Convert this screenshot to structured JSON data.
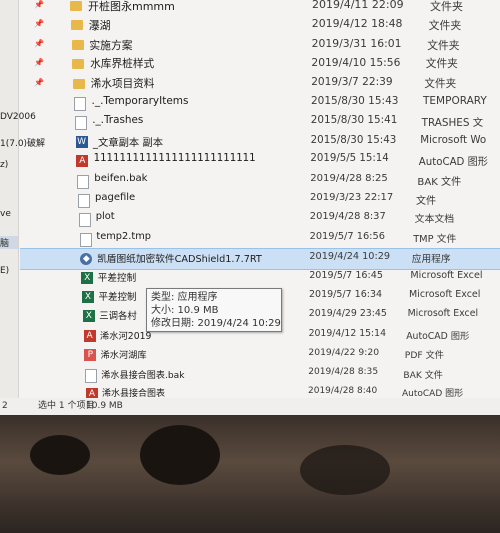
{
  "left_pane": {
    "items": [
      "DV2006",
      "1(7.0)破解",
      "z)",
      "ve",
      "脑",
      "E)"
    ]
  },
  "files": [
    {
      "name": "开桩图永mmmm",
      "date": "2019/4/11 22:09",
      "type": "文件夹",
      "icon": "folder",
      "pinned": true
    },
    {
      "name": "瀑湖",
      "date": "2019/4/12 18:48",
      "type": "文件夹",
      "icon": "folder",
      "pinned": true
    },
    {
      "name": "实施方案",
      "date": "2019/3/31 16:01",
      "type": "文件夹",
      "icon": "folder",
      "pinned": true
    },
    {
      "name": "水库界桩样式",
      "date": "2019/4/10 15:56",
      "type": "文件夹",
      "icon": "folder",
      "pinned": true
    },
    {
      "name": "浠水项目资料",
      "date": "2019/3/7 22:39",
      "type": "文件夹",
      "icon": "folder",
      "pinned": true
    },
    {
      "name": "._.TemporaryItems",
      "date": "2015/8/30 15:43",
      "type": "TEMPORARY",
      "icon": "file",
      "pinned": false
    },
    {
      "name": "._.Trashes",
      "date": "2015/8/30 15:41",
      "type": "TRASHES 文",
      "icon": "file",
      "pinned": false
    },
    {
      "name": "_文章副本 副本",
      "date": "2015/8/30 15:43",
      "type": "Microsoft Wo",
      "icon": "word",
      "pinned": false
    },
    {
      "name": "1111111111111111111111111",
      "date": "2019/5/5 15:14",
      "type": "AutoCAD 图形",
      "icon": "cad",
      "pinned": false
    },
    {
      "name": "beifen.bak",
      "date": "2019/4/28 8:25",
      "type": "BAK 文件",
      "icon": "file",
      "pinned": false
    },
    {
      "name": "pagefile",
      "date": "2019/3/23 22:17",
      "type": "文件",
      "icon": "file",
      "pinned": false
    },
    {
      "name": "plot",
      "date": "2019/4/28 8:37",
      "type": "文本文档",
      "icon": "file",
      "pinned": false
    },
    {
      "name": "temp2.tmp",
      "date": "2019/5/7 16:56",
      "type": "TMP 文件",
      "icon": "file",
      "pinned": false
    },
    {
      "name": "凯盾图纸加密软件CADShield1.7.7RT",
      "date": "2019/4/24 10:29",
      "type": "应用程序",
      "icon": "app",
      "pinned": false,
      "highlighted": true
    },
    {
      "name": "平差控制",
      "date": "2019/5/7 16:45",
      "type": "Microsoft Excel",
      "icon": "excel",
      "pinned": false
    },
    {
      "name": "平差控制",
      "date": "2019/5/7 16:34",
      "type": "Microsoft Excel",
      "icon": "excel",
      "pinned": false
    },
    {
      "name": "三调各村",
      "date": "2019/4/29 23:45",
      "type": "Microsoft Excel",
      "icon": "excel",
      "pinned": false
    },
    {
      "name": "浠水河2019",
      "date": "2019/4/12 15:14",
      "type": "AutoCAD 图形",
      "icon": "cad",
      "pinned": false
    },
    {
      "name": "浠水河湖库",
      "date": "2019/4/22 9:20",
      "type": "PDF 文件",
      "icon": "pdf",
      "pinned": false
    },
    {
      "name": "浠水县接合图表.bak",
      "date": "2019/4/28 8:35",
      "type": "BAK 文件",
      "icon": "file",
      "pinned": false
    },
    {
      "name": "浠水县接合图表",
      "date": "2019/4/28 8:40",
      "type": "AutoCAD 图形",
      "icon": "cad",
      "pinned": false
    }
  ],
  "tooltip": {
    "type_line": "类型: 应用程序",
    "size_line": "大小: 10.9 MB",
    "date_line": "修改日期: 2019/4/24 10:29"
  },
  "status_bar": {
    "count": "2",
    "selection": "选中 1 个项目",
    "size": "10.9 MB"
  },
  "colors": {
    "highlight": "#cce0f5",
    "folder": "#e8b84a"
  }
}
